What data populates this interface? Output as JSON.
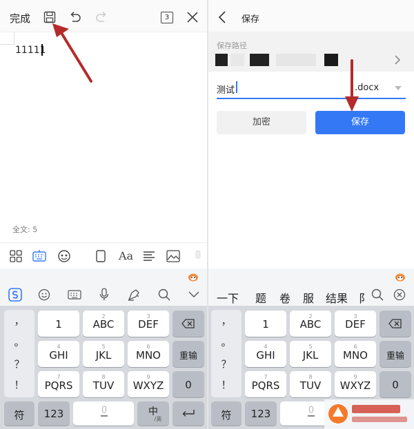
{
  "left": {
    "top_bar": {
      "done_label": "完成",
      "icons": [
        "save-icon",
        "undo-icon",
        "redo-icon",
        "page-count-icon",
        "close-icon"
      ],
      "page_count": "3"
    },
    "document": {
      "text": "11111"
    },
    "word_count": "全文: 5",
    "toolbar_icons": [
      "grid-icon",
      "keyboard-icon",
      "emoji-face-icon",
      "frame-icon",
      "font-icon",
      "align-icon",
      "image-icon",
      "mic-icon"
    ]
  },
  "right": {
    "top_bar": {
      "title": "保存"
    },
    "path_label": "保存路径",
    "filename": "测试",
    "extension": ".docx",
    "encrypt_button": "加密",
    "save_button": "保存",
    "candidates": [
      "一下",
      "题",
      "卷",
      "服",
      "结果",
      "阝"
    ]
  },
  "keyboard": {
    "toolbar_icons": [
      "sogou-logo-icon",
      "smile-icon",
      "keyboard-icon",
      "mic-icon",
      "pen-icon",
      "search-icon",
      "chevron-down-icon"
    ],
    "punctuation": [
      "，",
      "。",
      "？",
      "！"
    ],
    "rows": [
      [
        {
          "main": "1",
          "sub": ""
        },
        {
          "main": "ABC",
          "sub": "2"
        },
        {
          "main": "DEF",
          "sub": "3"
        }
      ],
      [
        {
          "main": "GHI",
          "sub": "4"
        },
        {
          "main": "JKL",
          "sub": "5"
        },
        {
          "main": "MNO",
          "sub": "6"
        }
      ],
      [
        {
          "main": "PQRS",
          "sub": "7"
        },
        {
          "main": "TUV",
          "sub": "8"
        },
        {
          "main": "WXYZ",
          "sub": "9"
        }
      ]
    ],
    "reinput": "重输",
    "zero": "0",
    "symbol": "符",
    "num": "123",
    "lang_main": "中",
    "lang_sub": "/英"
  },
  "colors": {
    "accent": "#3478f6",
    "arrow": "#b52a2a"
  }
}
